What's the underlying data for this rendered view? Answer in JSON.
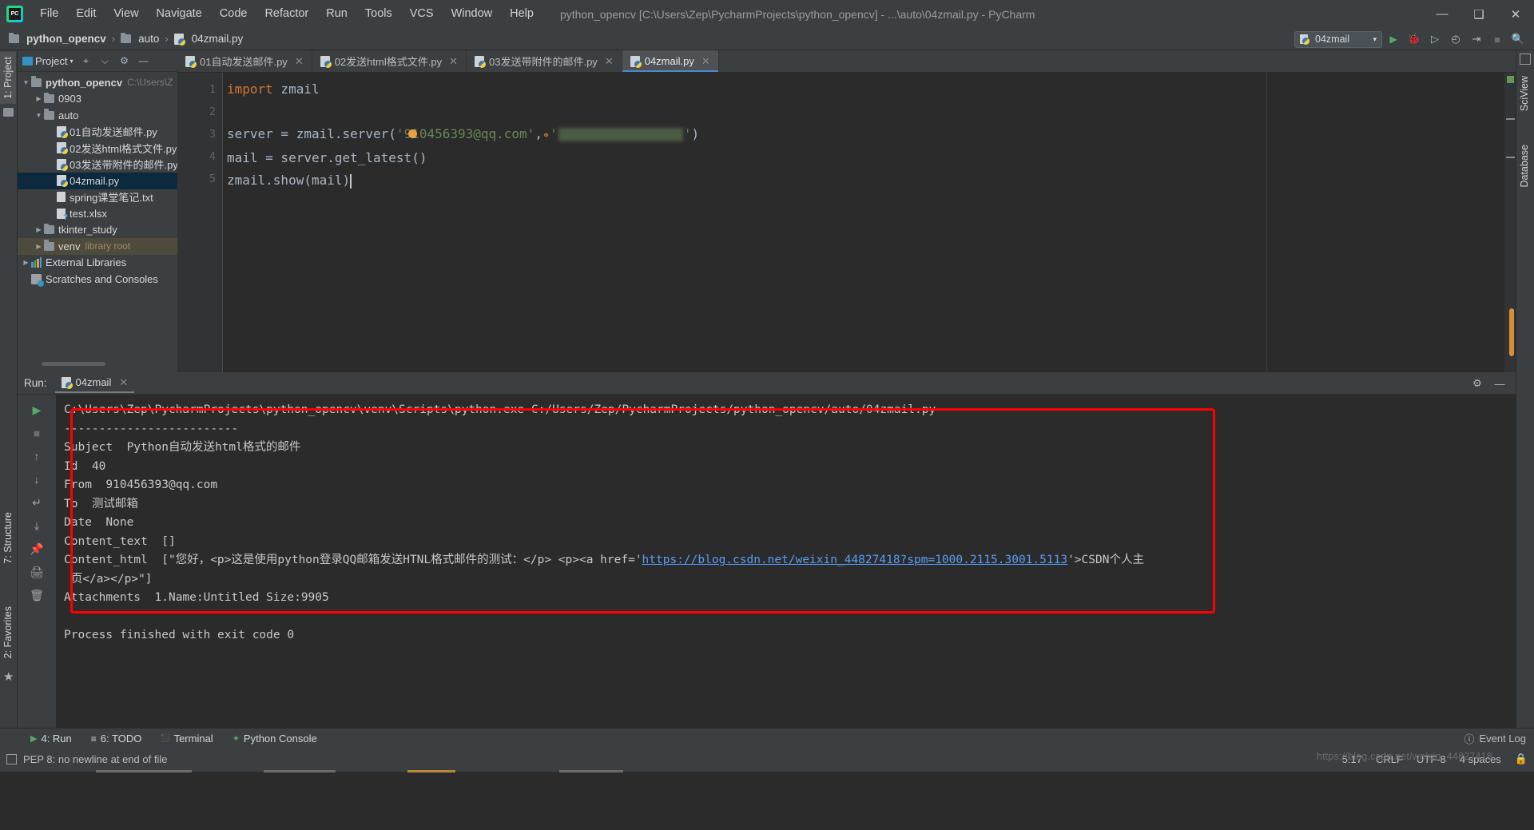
{
  "titlebar": {
    "menu": [
      "File",
      "Edit",
      "View",
      "Navigate",
      "Code",
      "Refactor",
      "Run",
      "Tools",
      "VCS",
      "Window",
      "Help"
    ],
    "window_title": "python_opencv [C:\\Users\\Zep\\PycharmProjects\\python_opencv] - ...\\auto\\04zmail.py - PyCharm",
    "minimize": "—",
    "maximize": "❑",
    "close": "✕"
  },
  "breadcrumb": {
    "project": "python_opencv",
    "folder": "auto",
    "file": "04zmail.py",
    "separator": "›"
  },
  "navbar_right": {
    "run_config": "04zmail",
    "dropdown_caret": "▾",
    "run": "▶",
    "debug": "🐞",
    "run_coverage": "▷",
    "profile": "◴",
    "attach": "⇥",
    "stop": "■",
    "search": "🔍"
  },
  "left_strip": {
    "project_tab": "1: Project",
    "structure_tab": "7: Structure",
    "favorites_tab": "2: Favorites"
  },
  "right_strip": {
    "sci_view": "SciView",
    "database": "Database"
  },
  "project_panel": {
    "title": "Project",
    "caret": "▾",
    "locate_icon": "⌖",
    "collapse_icon": "⌵",
    "settings_icon": "⚙",
    "hide_icon": "—",
    "tree": [
      {
        "label": "python_opencv",
        "hint": "C:\\Users\\Z",
        "depth": 0,
        "arrow": "▼",
        "type": "folder",
        "bold": true,
        "state": "normal"
      },
      {
        "label": "0903",
        "hint": "",
        "depth": 1,
        "arrow": "▶",
        "type": "folder",
        "bold": false,
        "state": "normal"
      },
      {
        "label": "auto",
        "hint": "",
        "depth": 1,
        "arrow": "▼",
        "type": "folder",
        "bold": false,
        "state": "normal"
      },
      {
        "label": "01自动发送邮件.py",
        "hint": "",
        "depth": 2,
        "arrow": "",
        "type": "py",
        "bold": false,
        "state": "normal"
      },
      {
        "label": "02发送html格式文件.py",
        "hint": "",
        "depth": 2,
        "arrow": "",
        "type": "py",
        "bold": false,
        "state": "normal"
      },
      {
        "label": "03发送带附件的邮件.py",
        "hint": "",
        "depth": 2,
        "arrow": "",
        "type": "py",
        "bold": false,
        "state": "normal"
      },
      {
        "label": "04zmail.py",
        "hint": "",
        "depth": 2,
        "arrow": "",
        "type": "py",
        "bold": false,
        "state": "selected"
      },
      {
        "label": "spring课堂笔记.txt",
        "hint": "",
        "depth": 2,
        "arrow": "",
        "type": "txt",
        "bold": false,
        "state": "normal"
      },
      {
        "label": "test.xlsx",
        "hint": "",
        "depth": 2,
        "arrow": "",
        "type": "xlsx",
        "bold": false,
        "state": "normal"
      },
      {
        "label": "tkinter_study",
        "hint": "",
        "depth": 1,
        "arrow": "▶",
        "type": "folder",
        "bold": false,
        "state": "normal"
      },
      {
        "label": "venv",
        "hint": "library root",
        "depth": 1,
        "arrow": "▶",
        "type": "folder",
        "bold": false,
        "state": "highlight"
      },
      {
        "label": "External Libraries",
        "hint": "",
        "depth": 0,
        "arrow": "▶",
        "type": "lib",
        "bold": false,
        "state": "normal"
      },
      {
        "label": "Scratches and Consoles",
        "hint": "",
        "depth": 0,
        "arrow": "",
        "type": "scratch",
        "bold": false,
        "state": "normal"
      }
    ]
  },
  "editor": {
    "tabs": [
      {
        "label": "01自动发送邮件.py",
        "active": false,
        "close": "✕"
      },
      {
        "label": "02发送html格式文件.py",
        "active": false,
        "close": "✕"
      },
      {
        "label": "03发送带附件的邮件.py",
        "active": false,
        "close": "✕"
      },
      {
        "label": "04zmail.py",
        "active": true,
        "close": "✕"
      }
    ],
    "line_numbers": [
      "1",
      "2",
      "3",
      "4",
      "5"
    ],
    "code": {
      "l1_kw": "import",
      "l1_mod": " zmail",
      "l3_a": "server = zmail.server(",
      "l3_str": "'910456393@qq.com'",
      "l3_comma": ",",
      "l3_quote1": "'",
      "l3_quote2": "'",
      "l3_end": ")",
      "l4": "mail = server.get_latest()",
      "l5": "zmail.show(mail)"
    }
  },
  "run_panel": {
    "label": "Run:",
    "tab_name": "04zmail",
    "tab_close": "✕",
    "settings_icon": "⚙",
    "hide_icon": "—",
    "toolbar": {
      "rerun": "▶",
      "stop": "■",
      "up": "↑",
      "down": "↓",
      "wrap": "↵",
      "export": "⤓",
      "pin": "📌",
      "print": "🖨",
      "trash": "🗑"
    },
    "console": {
      "command": "C:\\Users\\Zep\\PycharmProjects\\python_opencv\\venv\\Scripts\\python.exe C:/Users/Zep/PycharmProjects/python_opencv/auto/04zmail.py",
      "divider": "-------------------------",
      "subject_key": "Subject",
      "subject_val": "Python自动发送html格式的邮件",
      "id_key": "Id",
      "id_val": "40",
      "from_key": "From",
      "from_val": "910456393@qq.com",
      "to_key": "To",
      "to_val": "测试邮箱",
      "date_key": "Date",
      "date_val": "None",
      "content_text_key": "Content_text",
      "content_text_val": "[]",
      "content_html_key": "Content_html",
      "content_html_pre": "[\"您好，<p>这是使用python登录QQ邮箱发送HTNL格式邮件的测试：</p> <p><a href='",
      "content_html_link": "https://blog.csdn.net/weixin_44827418?spm=1000.2115.3001.5113",
      "content_html_post": "'>CSDN个人主",
      "content_html_wrap": "页</a></p>\"]",
      "attachments_key": "Attachments",
      "attachments_val": "1.Name:Untitled Size:9905",
      "finished": "Process finished with exit code 0"
    },
    "highlight_color": "#fe0000"
  },
  "bottom_bar": {
    "run": "4: Run",
    "run_icon": "▶",
    "todo": "6: TODO",
    "todo_icon": "≡",
    "terminal": "Terminal",
    "terminal_icon": "⬛",
    "python_console": "Python Console",
    "python_console_icon": "✦",
    "event_log": "Event Log",
    "event_log_icon": "ⓘ"
  },
  "status_bar": {
    "message": "PEP 8: no newline at end of file",
    "caret_position": "5:17",
    "line_separator": "CRLF",
    "encoding": "UTF-8",
    "indent": "4 spaces",
    "lock_icon": "🔒"
  },
  "watermark": "https://blog.csdn.net/weixin_44827418",
  "colors": {
    "accent": "#4a88c7",
    "red_highlight": "#fe0000",
    "link": "#589df6",
    "keyword": "#cc7832",
    "string": "#6a8759"
  }
}
